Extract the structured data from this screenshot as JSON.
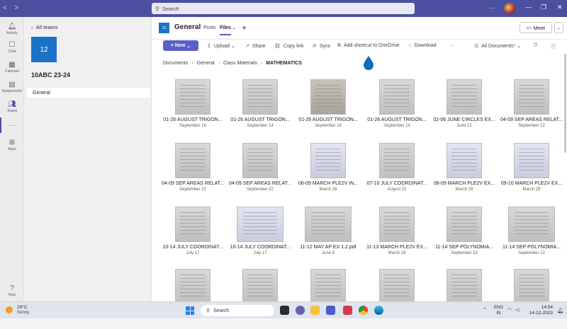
{
  "search": {
    "placeholder": "Search"
  },
  "rail": [
    {
      "label": "Activity",
      "icon": "bell-icon"
    },
    {
      "label": "Chat",
      "icon": "chat-icon"
    },
    {
      "label": "Calendar",
      "icon": "calendar-icon"
    },
    {
      "label": "Assignments",
      "icon": "assignments-icon"
    },
    {
      "label": "Teams",
      "icon": "teams-icon"
    },
    {
      "label": "Apps",
      "icon": "apps-icon"
    },
    {
      "label": "Help",
      "icon": "help-icon"
    }
  ],
  "team": {
    "back_label": "All teams",
    "tile": "12",
    "name": "10ABC 23-24",
    "channel": "General"
  },
  "channel_header": {
    "tile": "12",
    "name": "General",
    "tabs": [
      "Posts",
      "Files"
    ],
    "meet_label": "Meet"
  },
  "commands": {
    "new": "New",
    "upload": "Upload",
    "share": "Share",
    "copy_link": "Copy link",
    "sync": "Sync",
    "shortcut": "Add shortcut to OneDrive",
    "download": "Download",
    "more": "···",
    "view": "All Documents*"
  },
  "breadcrumb": [
    "Documents",
    "General",
    "Class Materials",
    "MATHEMATICS"
  ],
  "files": [
    {
      "name": "01-26 AUGUST TRIGON...",
      "date": "September 14"
    },
    {
      "name": "01-26 AUGUST TRIGON...",
      "date": "September 14"
    },
    {
      "name": "01-26 AUGUST TRIGON...",
      "date": "September 14"
    },
    {
      "name": "01-26 AUGUST TRIGON...",
      "date": "September 14"
    },
    {
      "name": "02-06 JUNE CIRCLES EX...",
      "date": "June 12"
    },
    {
      "name": "04-09 SEP AREAS RELAT...",
      "date": "September 22"
    },
    {
      "name": "04-09 SEP AREAS RELAT...",
      "date": "September 22"
    },
    {
      "name": "04-09 SEP AREAS RELAT...",
      "date": "September 22"
    },
    {
      "name": "06-09 MARCH PLE2V IN...",
      "date": "March 29"
    },
    {
      "name": "07-10 JULY COORDINAT...",
      "date": "August 22"
    },
    {
      "name": "08-09 MARCH PLE2V EX...",
      "date": "March 29"
    },
    {
      "name": "09-10 MARCH PLE2V EX...",
      "date": "March 29"
    },
    {
      "name": "10-14 JULY COORDINAT...",
      "date": "July 17"
    },
    {
      "name": "10-14 JULY COORDINAT...",
      "date": "July 17"
    },
    {
      "name": "11-12 MAY AP EX 1.2.pdf",
      "date": "June 8"
    },
    {
      "name": "11-13 MARCH PLE2V EX...",
      "date": "March 29"
    },
    {
      "name": "11-14 SEP POLYNOMIA...",
      "date": "September 22"
    },
    {
      "name": "11-14 SEP POLYNOMIA...",
      "date": "September 22"
    },
    {
      "name": "",
      "date": ""
    },
    {
      "name": "",
      "date": ""
    },
    {
      "name": "",
      "date": ""
    },
    {
      "name": "",
      "date": ""
    },
    {
      "name": "",
      "date": ""
    },
    {
      "name": "",
      "date": ""
    }
  ],
  "taskbar": {
    "temp": "29°C",
    "condition": "Sunny",
    "search": "Search",
    "lang_top": "ENG",
    "lang_bottom": "IN",
    "time": "14:54",
    "date": "14-12-2023"
  }
}
